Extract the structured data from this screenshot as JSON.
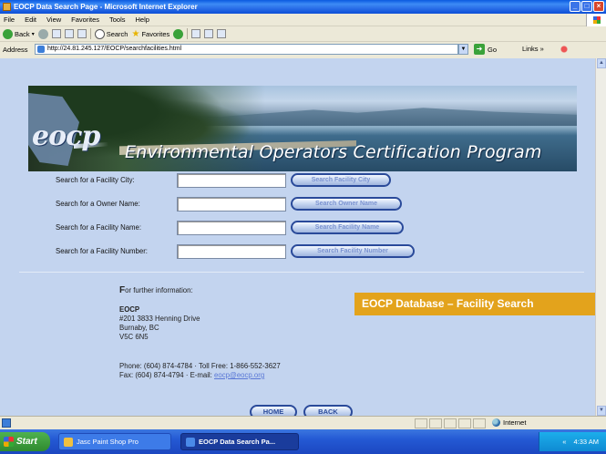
{
  "window": {
    "title": "EOCP Data Search Page - Microsoft Internet Explorer",
    "controls": [
      "_",
      "□",
      "×"
    ]
  },
  "menubar": {
    "items": [
      "File",
      "Edit",
      "View",
      "Favorites",
      "Tools",
      "Help"
    ]
  },
  "toolbar": {
    "back": "Back",
    "search": "Search",
    "favorites": "Favorites"
  },
  "addressbar": {
    "label": "Address",
    "url": "http://24.81.245.127/EOCP/searchfacilities.html",
    "go": "Go",
    "links": "Links"
  },
  "banner": {
    "logo": "eocp",
    "program_name": "Environmental Operators Certification Program"
  },
  "search_rows": [
    {
      "label": "Search for a Facility City:",
      "button": "Search Facility City",
      "value": ""
    },
    {
      "label": "Search for a Owner Name:",
      "button": "Search Owner Name",
      "value": ""
    },
    {
      "label": "Search for a Facility Name:",
      "button": "Search Facility Name",
      "value": ""
    },
    {
      "label": "Search for a Facility Number:",
      "button": "Search Facility Number",
      "value": ""
    }
  ],
  "info": {
    "heading_first": "F",
    "heading_rest": "or further information:",
    "org": "EOCP",
    "address1": "#201 3833 Henning Drive",
    "address2": "Burnaby, BC",
    "address3": "V5C 6N5",
    "phone": "Phone: (604) 874-4784 · Toll Free: 1-866-552-3627",
    "fax_prefix": "Fax: (604) 874-4794 · E-mail: ",
    "email": "eocp@eocp.org"
  },
  "nav": {
    "home": "HOME",
    "back": "BACK"
  },
  "caption": "EOCP Database – Facility Search",
  "statusbar": {
    "zone": "Internet"
  },
  "taskbar": {
    "start": "Start",
    "task1": "Jasc Paint Shop Pro",
    "task2": "EOCP Data Search Pa...",
    "tray_arrows": "«",
    "clock": "4:33 AM"
  }
}
